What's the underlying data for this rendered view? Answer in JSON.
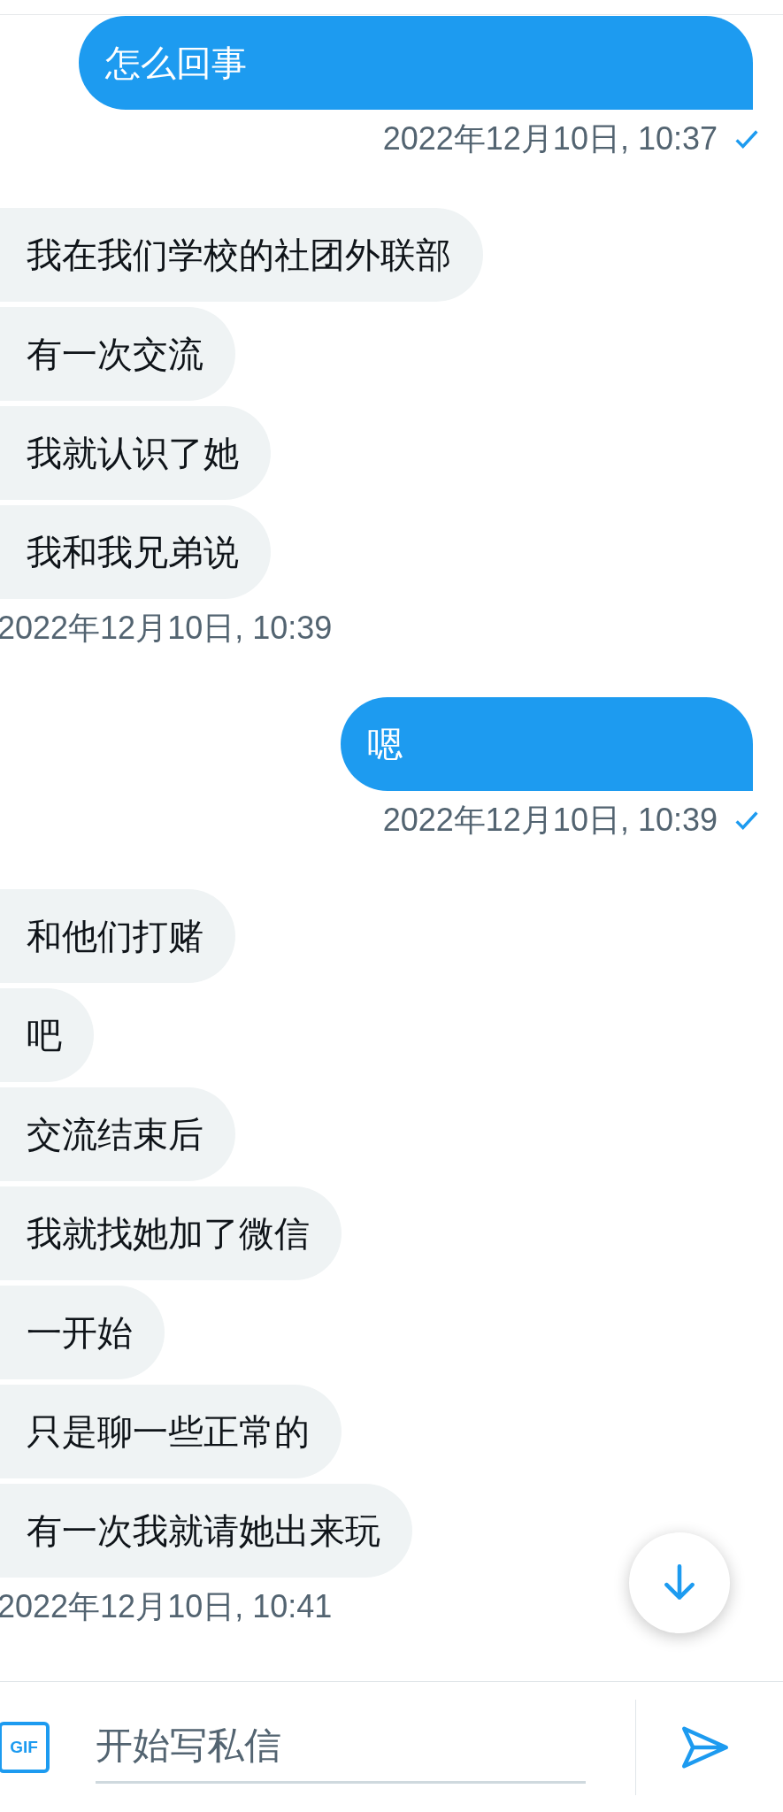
{
  "conversation": [
    {
      "kind": "sent",
      "bubbles": [
        "怎么回事"
      ],
      "time": "2022年12月10日, 10:37",
      "read": true
    },
    {
      "kind": "received",
      "bubbles": [
        "我在我们学校的社团外联部",
        "有一次交流",
        "我就认识了她",
        "我和我兄弟说"
      ],
      "time": "2022年12月10日, 10:39"
    },
    {
      "kind": "sent",
      "bubbles": [
        "嗯"
      ],
      "time": "2022年12月10日, 10:39",
      "read": true
    },
    {
      "kind": "received",
      "bubbles": [
        "和他们打赌",
        "吧",
        "交流结束后",
        "我就找她加了微信",
        "一开始",
        "只是聊一些正常的",
        "有一次我就请她出来玩"
      ],
      "time": "2022年12月10日, 10:41"
    }
  ],
  "composer": {
    "gif_label": "GIF",
    "placeholder": "开始写私信"
  }
}
